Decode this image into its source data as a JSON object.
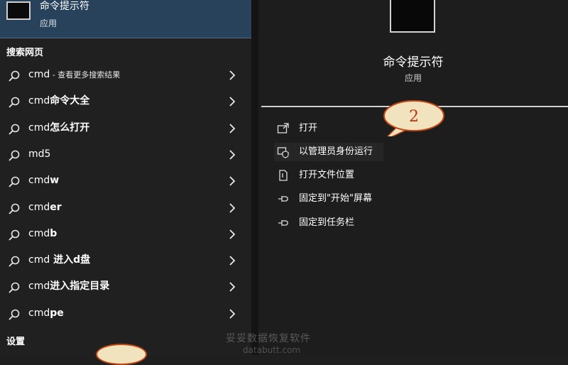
{
  "top_result": {
    "title": "命令提示符",
    "subtitle": "应用"
  },
  "sections": {
    "web": "搜索网页",
    "settings": "设置"
  },
  "web_results": [
    {
      "prefix": "cmd",
      "suffix": " - 查看更多搜索结果"
    },
    {
      "prefix": "cmd",
      "suffix": "命令大全"
    },
    {
      "prefix": "cmd",
      "suffix": "怎么打开"
    },
    {
      "prefix": "md5",
      "suffix": ""
    },
    {
      "prefix": "cmd",
      "suffix": "w"
    },
    {
      "prefix": "cmd",
      "suffix": "er"
    },
    {
      "prefix": "cmd",
      "suffix": "b"
    },
    {
      "prefix": "cmd",
      "suffix": " 进入d盘"
    },
    {
      "prefix": "cmd",
      "suffix": "进入指定目录"
    },
    {
      "prefix": "cmd",
      "suffix": "pe"
    }
  ],
  "detail": {
    "title": "命令提示符",
    "subtitle": "应用"
  },
  "actions": [
    {
      "label": "打开",
      "icon": "open-icon"
    },
    {
      "label": "以管理员身份运行",
      "icon": "admin-shield-icon"
    },
    {
      "label": "打开文件位置",
      "icon": "file-location-icon"
    },
    {
      "label": "固定到\"开始\"屏幕",
      "icon": "pin-icon"
    },
    {
      "label": "固定到任务栏",
      "icon": "pin-icon"
    }
  ],
  "callout": {
    "number": "2"
  },
  "watermark": {
    "line1": "妥妥数据恢复软件",
    "line2": "databutt.com"
  },
  "colors": {
    "selected_bg": "#27425a",
    "pane_bg": "#202020",
    "callout_fill": "#f1e3bd",
    "callout_stroke": "#c04818",
    "callout_text": "#c03010"
  }
}
